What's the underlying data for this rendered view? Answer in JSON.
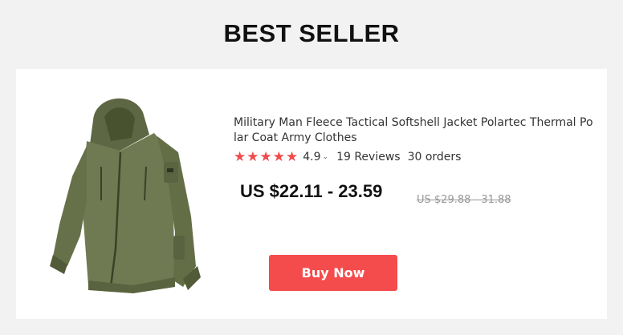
{
  "header": {
    "title": "BEST SELLER"
  },
  "product": {
    "title": "Military Man Fleece Tactical Softshell Jacket Polartec Thermal Polar Coat Army Clothes",
    "rating": "4.9",
    "reviews": "19 Reviews",
    "orders": "30 orders",
    "price": "US $22.11 - 23.59",
    "original_price": "US $29.88 - 31.88",
    "image": "olive-green-fleece-jacket"
  },
  "buy_button": {
    "label": "Buy Now"
  },
  "colors": {
    "star": "#f04a4a",
    "button": "#f44c4c",
    "jacket": "#6f7a52"
  }
}
